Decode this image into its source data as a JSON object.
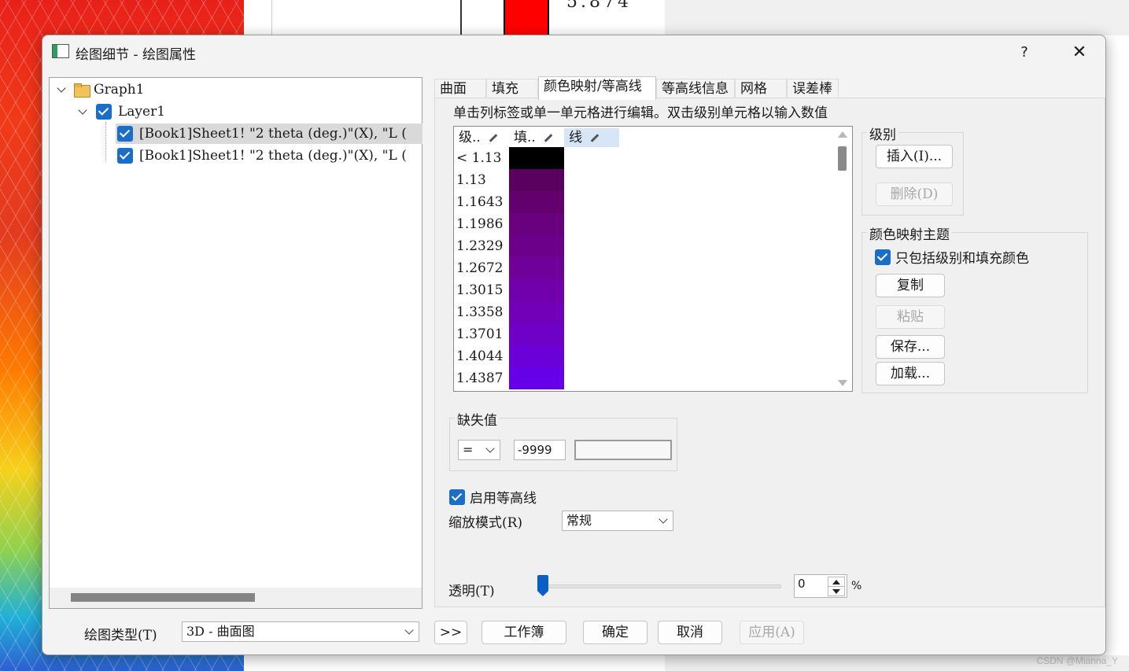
{
  "background": {
    "plot_number": "5.874",
    "watermark": "CSDN @Mianna_Y"
  },
  "dialog": {
    "title": "绘图细节 - 绘图属性",
    "help": "?",
    "close": "✕"
  },
  "tree": {
    "root": "Graph1",
    "layer": "Layer1",
    "items": [
      "[Book1]Sheet1! \"2 theta (deg.)\"(X), \"L (",
      "[Book1]Sheet1! \"2 theta (deg.)\"(X), \"L ("
    ]
  },
  "tabs": [
    "曲面",
    "填充",
    "颜色映射/等高线",
    "等高线信息",
    "网格",
    "误差棒"
  ],
  "active_tab": "颜色映射/等高线",
  "colormap": {
    "hint": "单击列标签或单一单元格进行编辑。双击级别单元格以输入数值",
    "columns": [
      "级..",
      "填..",
      "线"
    ],
    "levels": [
      "< 1.13",
      "1.13",
      "1.1643",
      "1.1986",
      "1.2329",
      "1.2672",
      "1.3015",
      "1.3358",
      "1.3701",
      "1.4044",
      "1.4387"
    ],
    "fill_colors": [
      "#000000",
      "#5a005e",
      "#63006e",
      "#69007d",
      "#6d008b",
      "#70009a",
      "#7200aa",
      "#7200b9",
      "#6f00c8",
      "#6b00d8",
      "#6600e8"
    ]
  },
  "levels_group": {
    "label": "级别",
    "insert": "插入(I)...",
    "delete": "删除(D)"
  },
  "theme_group": {
    "label": "颜色映射主题",
    "include_only": "只包括级别和填充颜色",
    "copy": "复制",
    "paste": "粘贴",
    "save": "保存...",
    "load": "加载..."
  },
  "missing": {
    "label": "缺失值",
    "operator": "=",
    "value": "-9999",
    "color_value": ""
  },
  "contour": {
    "enable_label": "启用等高线",
    "scale_label": "缩放模式(R)",
    "scale_value": "常规"
  },
  "transparency": {
    "label": "透明(T)",
    "value": "0",
    "unit": "%",
    "level": 0
  },
  "bottom": {
    "plot_type_label": "绘图类型(T)",
    "plot_type_value": "3D - 曲面图",
    "more": ">>",
    "workbook": "工作簿",
    "ok": "确定",
    "cancel": "取消",
    "apply": "应用(A)"
  }
}
